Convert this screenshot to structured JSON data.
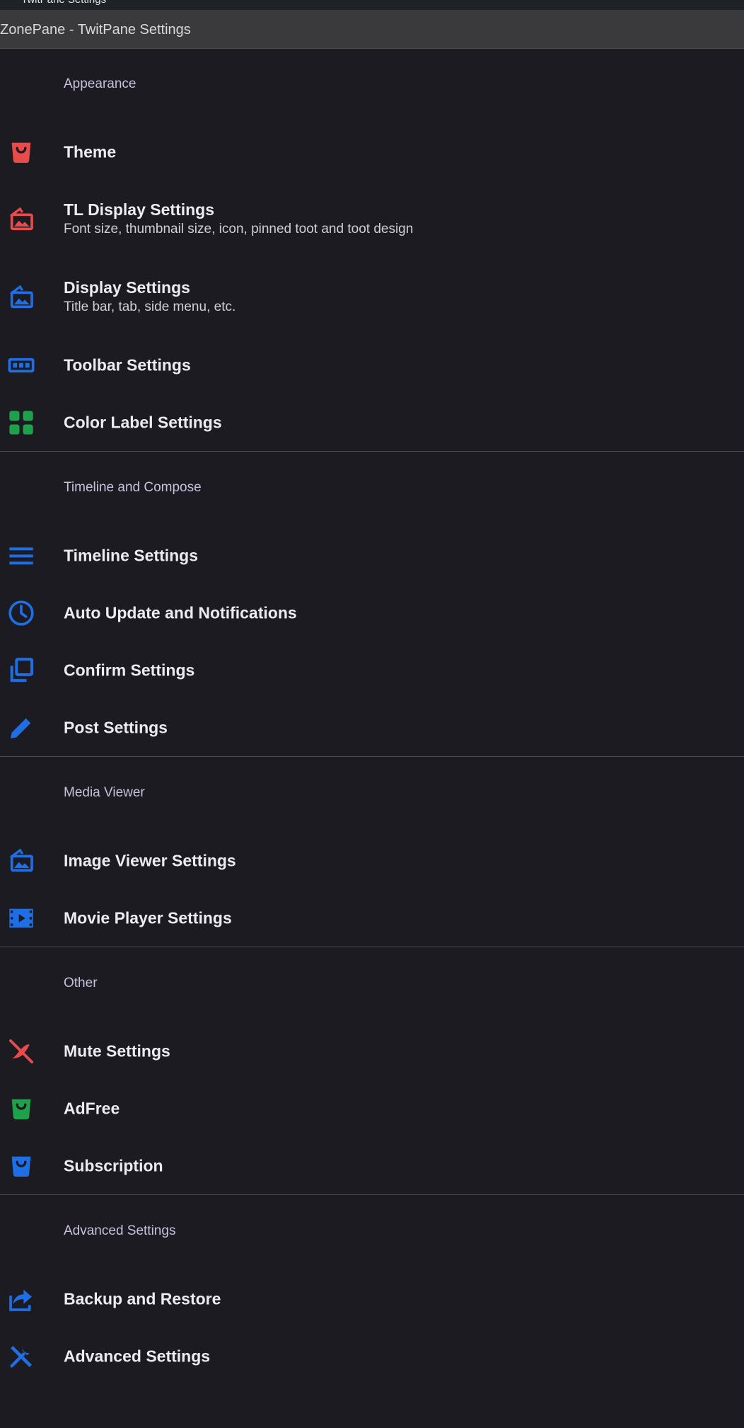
{
  "window": {
    "top_strip_title": "TwitPane Settings",
    "app_title": "ZonePane - TwitPane Settings"
  },
  "colors": {
    "background": "#1c1b21",
    "red": "#e94a4a",
    "blue": "#1e6fe6",
    "green": "#1ea14b"
  },
  "sections": [
    {
      "title": "Appearance",
      "items": [
        {
          "label": "Theme",
          "icon": "shopping-bag-icon",
          "color": "red"
        },
        {
          "label": "TL Display Settings",
          "sub": "Font size, thumbnail size, icon, pinned toot and toot design",
          "icon": "photos-icon",
          "color": "red"
        },
        {
          "label": "Display Settings",
          "sub": "Title bar, tab, side menu, etc.",
          "icon": "photos-icon",
          "color": "blue"
        },
        {
          "label": "Toolbar Settings",
          "icon": "toolbar-icon",
          "color": "blue"
        },
        {
          "label": "Color Label Settings",
          "icon": "grid-icon",
          "color": "green"
        }
      ]
    },
    {
      "title": "Timeline and Compose",
      "items": [
        {
          "label": "Timeline Settings",
          "icon": "menu-lines-icon",
          "color": "blue"
        },
        {
          "label": "Auto Update and Notifications",
          "icon": "clock-icon",
          "color": "blue"
        },
        {
          "label": "Confirm Settings",
          "icon": "copy-icon",
          "color": "blue"
        },
        {
          "label": "Post Settings",
          "icon": "pencil-icon",
          "color": "blue"
        }
      ]
    },
    {
      "title": "Media Viewer",
      "items": [
        {
          "label": "Image Viewer Settings",
          "icon": "photos-icon",
          "color": "blue"
        },
        {
          "label": "Movie Player Settings",
          "icon": "film-icon",
          "color": "blue"
        }
      ]
    },
    {
      "title": "Other",
      "items": [
        {
          "label": "Mute Settings",
          "icon": "mute-icon",
          "color": "red"
        },
        {
          "label": "AdFree",
          "icon": "shopping-bag-icon",
          "color": "green"
        },
        {
          "label": "Subscription",
          "icon": "shopping-bag-icon",
          "color": "blue"
        }
      ]
    },
    {
      "title": "Advanced Settings",
      "items": [
        {
          "label": "Backup and Restore",
          "icon": "share-icon",
          "color": "blue"
        },
        {
          "label": "Advanced Settings",
          "icon": "tools-icon",
          "color": "blue"
        }
      ]
    }
  ]
}
